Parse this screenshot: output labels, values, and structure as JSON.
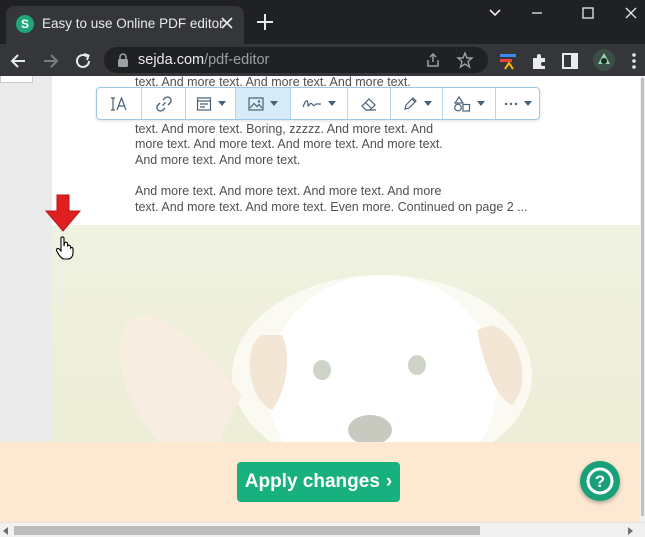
{
  "browser": {
    "tab": {
      "favicon_letter": "S",
      "title": "Easy to use Online PDF editor"
    },
    "address": {
      "domain": "sejda.com",
      "path": "/pdf-editor"
    }
  },
  "document": {
    "lines": [
      "text. And more text. And more text. And more text.",
      "text. And more text. Boring, zzzzz. And more text. And",
      "more text. And more text. And more text. And more text.",
      "And more text. And more text.",
      "And more text. And more text. And more text. And more",
      "text. And more text. And more text. Even more. Continued on page 2 ..."
    ]
  },
  "edit_toolbar": {
    "tools": [
      {
        "icon": "text-tool-icon",
        "dropdown": false,
        "active": false
      },
      {
        "icon": "link-icon",
        "dropdown": false,
        "active": false
      },
      {
        "icon": "forms-icon",
        "dropdown": true,
        "active": false
      },
      {
        "icon": "image-icon",
        "dropdown": true,
        "active": true
      },
      {
        "icon": "signature-icon",
        "dropdown": true,
        "active": false
      },
      {
        "icon": "eraser-icon",
        "dropdown": false,
        "active": false
      },
      {
        "icon": "annotate-pen-icon",
        "dropdown": true,
        "active": false
      },
      {
        "icon": "shapes-icon",
        "dropdown": true,
        "active": false
      },
      {
        "icon": "more-icon",
        "dropdown": true,
        "active": false
      }
    ]
  },
  "apply": {
    "label": "Apply changes",
    "chevron": "›"
  },
  "help": {
    "glyph": "?"
  },
  "colors": {
    "accent": "#18b07f",
    "apply_bar": "#fde9d2",
    "arrow": "#e02020"
  }
}
